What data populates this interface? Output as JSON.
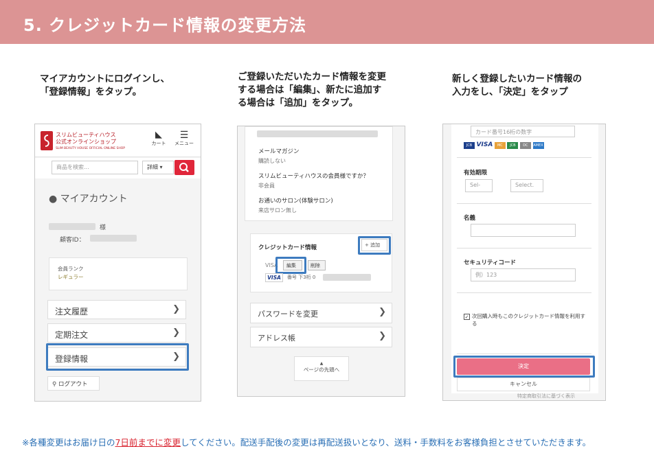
{
  "header": {
    "title": "5. クレジットカード情報の変更方法"
  },
  "captions": {
    "step1": [
      "マイアカウントにログインし、",
      "「登録情報」をタップ。"
    ],
    "step2": [
      "ご登録いただいたカード情報を変更",
      "する場合は「編集」、新たに追加す",
      "る場合は「追加」をタップ。"
    ],
    "step3": [
      "新しく登録したいカード情報の",
      "入力をし、「決定」をタップ"
    ]
  },
  "screen1": {
    "logo_line1": "スリムビューティハウス",
    "logo_line2": "公式オンラインショップ",
    "logo_line3": "SLIM BEAUTY HOUSE OFFICIAL ONLINE SHOP",
    "cart_label": "カート",
    "menu_label": "メニュー",
    "search_placeholder": "商品を検索...",
    "detail_label": "詳細 ▾",
    "my_account": "マイアカウント",
    "name_suffix": "様",
    "customer_id_label": "顧客ID：",
    "rank_label": "会員ランク",
    "rank_value": "レギュラー",
    "menu_items": [
      "注文履歴",
      "定期注文",
      "登録情報"
    ],
    "logout": "ログアウト"
  },
  "screen2": {
    "mail_mag_label": "メールマガジン",
    "mail_mag_value": "購読しない",
    "member_q": "スリムビューティハウスの会員様ですか？",
    "member_value": "非会員",
    "salon_label": "お通いのサロン(体験サロン)",
    "salon_value": "来店サロン無し",
    "card_section": "クレジットカード情報",
    "add_label": "+ 追加",
    "visa_text": "VISA",
    "edit_label": "編集",
    "delete_label": "削除",
    "card_brand": "VISA",
    "card_number_label": "番号 下3桁 0",
    "password_change": "パスワードを変更",
    "address_book": "アドレス帳",
    "page_top": "ページの先頭へ"
  },
  "screen3": {
    "card_placeholder": "カード番号16桁の数字",
    "card_brands": [
      "JCB",
      "VISA",
      "MC",
      "JCB",
      "DC",
      "AMEX"
    ],
    "expiry_label": "有効期限",
    "month_select": "Sel-",
    "year_select": "Select.",
    "name_label": "名義",
    "security_label": "セキュリティコード",
    "security_placeholder": "例）123",
    "save_card_text": "次回購入時もこのクレジットカード情報を利用する",
    "confirm_label": "決定",
    "cancel_label": "キャンセル",
    "bottom_text": "特定商取引法に基づく表示"
  },
  "footer": {
    "prefix": "※各種変更はお届け日の",
    "emphasis": "7日前までに変更",
    "suffix": "してください。配送手配後の変更は再配送扱いとなり、送料・手数料をお客様負担とさせていただきます。"
  },
  "colors": {
    "header": "#dc9494",
    "highlight": "#3d7bbf",
    "confirm": "#ea6f86",
    "search_btn": "#e0263a",
    "footer_text": "#2a6fb5",
    "footer_emphasis": "#d9232f"
  }
}
